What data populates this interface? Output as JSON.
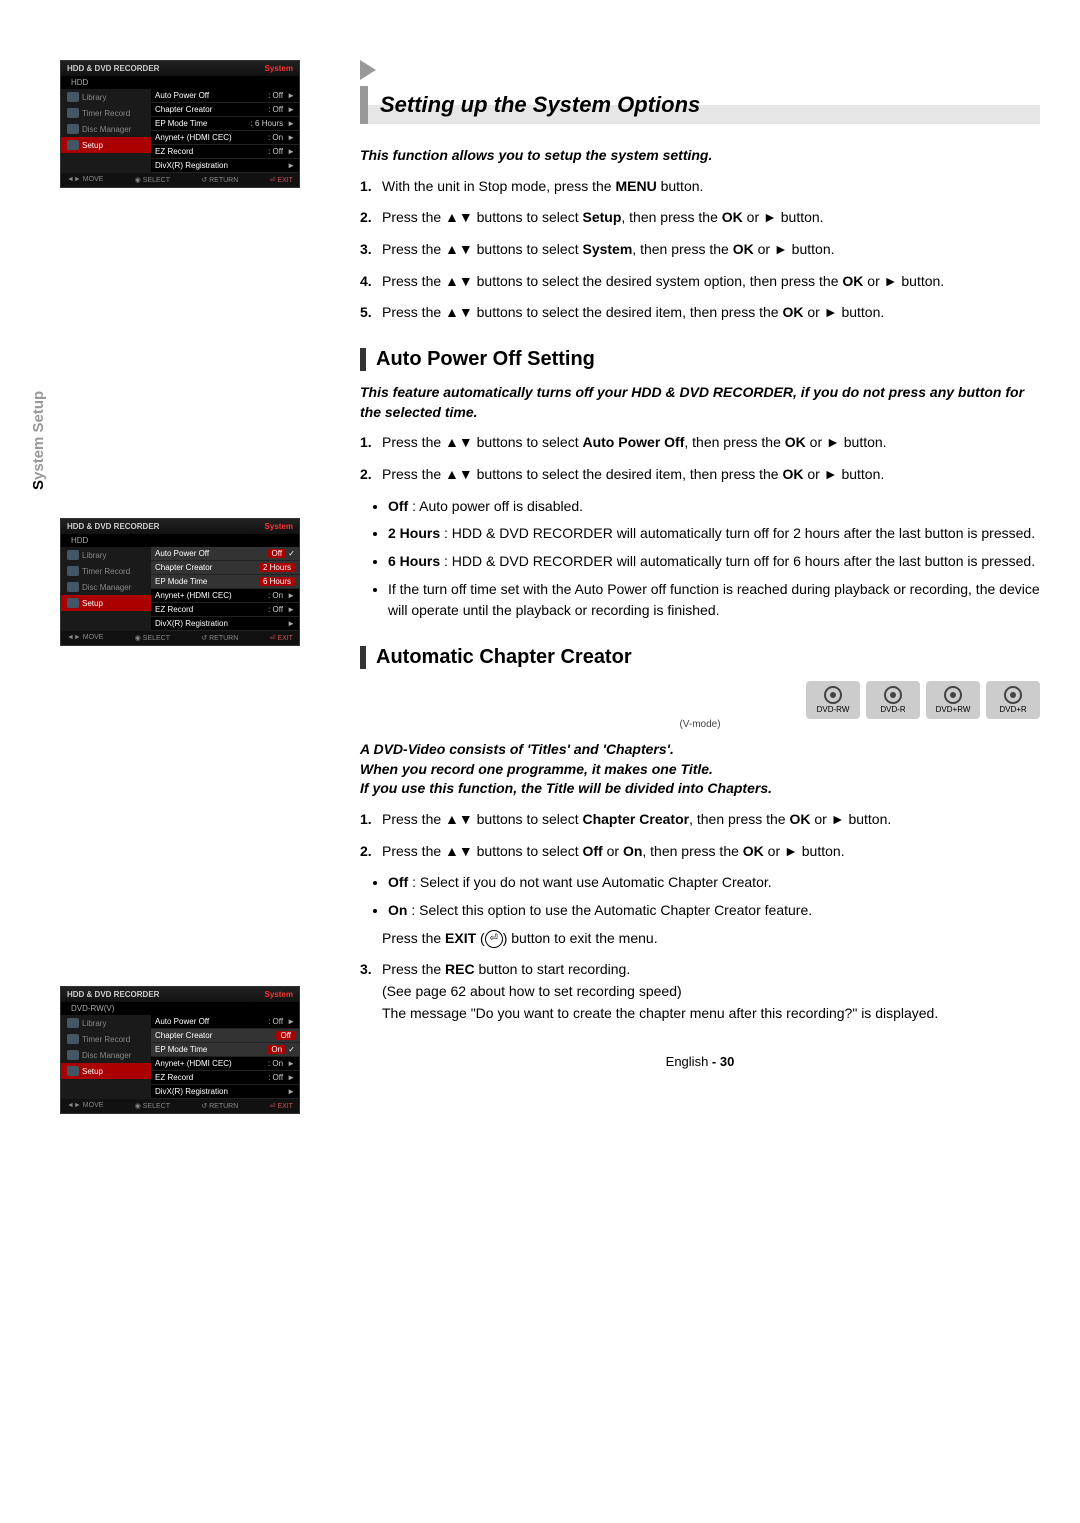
{
  "sideLabel": {
    "first": "S",
    "rest": "ystem Setup"
  },
  "osd": {
    "title": "HDD & DVD RECORDER",
    "system": "System",
    "nav": [
      "Library",
      "Timer Record",
      "Disc Manager",
      "Setup"
    ],
    "footer": {
      "move": "◄► MOVE",
      "select": "◉ SELECT",
      "return": "↺ RETURN",
      "exit": "⏎ EXIT"
    },
    "screen1": {
      "sub": "HDD",
      "rows": [
        {
          "label": "Auto Power Off",
          "val": ": Off",
          "arrow": "►"
        },
        {
          "label": "Chapter Creator",
          "val": ": Off",
          "arrow": "►"
        },
        {
          "label": "EP Mode Time",
          "val": ": 6 Hours",
          "arrow": "►"
        },
        {
          "label": "Anynet+ (HDMI CEC)",
          "val": ": On",
          "arrow": "►"
        },
        {
          "label": "EZ Record",
          "val": ": Off",
          "arrow": "►"
        },
        {
          "label": "DivX(R) Registration",
          "val": "",
          "arrow": "►"
        }
      ]
    },
    "screen2": {
      "sub": "HDD",
      "rows": [
        {
          "label": "Auto Power Off",
          "box": "Off",
          "check": "✓"
        },
        {
          "label": "Chapter Creator",
          "box": "2 Hours"
        },
        {
          "label": "EP Mode Time",
          "box": "6 Hours"
        },
        {
          "label": "Anynet+ (HDMI CEC)",
          "val": ": On",
          "arrow": "►"
        },
        {
          "label": "EZ Record",
          "val": ": Off",
          "arrow": "►"
        },
        {
          "label": "DivX(R) Registration",
          "val": "",
          "arrow": "►"
        }
      ]
    },
    "screen3": {
      "sub": "DVD-RW(V)",
      "rows": [
        {
          "label": "Auto Power Off",
          "val": ": Off",
          "arrow": "►"
        },
        {
          "label": "Chapter Creator",
          "box": "Off"
        },
        {
          "label": "EP Mode Time",
          "box": "On",
          "check": "✓"
        },
        {
          "label": "Anynet+ (HDMI CEC)",
          "val": ": On",
          "arrow": "►"
        },
        {
          "label": "EZ Record",
          "val": ": Off",
          "arrow": "►"
        },
        {
          "label": "DivX(R) Registration",
          "val": "",
          "arrow": "►"
        }
      ]
    }
  },
  "section1": {
    "title": "Setting up the System Options",
    "intro": "This function allows you to setup the system setting.",
    "steps": [
      {
        "n": "1.",
        "html": "With the unit in Stop mode, press the <b>MENU</b> button."
      },
      {
        "n": "2.",
        "html": "Press the ▲▼ buttons to select <b>Setup</b>, then press the <b>OK</b> or ► button."
      },
      {
        "n": "3.",
        "html": "Press the ▲▼ buttons to select <b>System</b>, then press the <b>OK</b> or ► button."
      },
      {
        "n": "4.",
        "html": "Press the ▲▼ buttons to select the desired  system option, then press the <b>OK</b> or ► button."
      },
      {
        "n": "5.",
        "html": "Press the ▲▼ buttons to select the desired item, then press the <b>OK</b> or ► button."
      }
    ]
  },
  "section2": {
    "title": "Auto Power Off Setting",
    "intro": "This feature automatically turns off your HDD & DVD RECORDER, if you do not press any button for the selected time.",
    "steps": [
      {
        "n": "1.",
        "html": "Press the ▲▼ buttons to select <b>Auto Power Off</b>, then press the <b>OK</b> or ► button."
      },
      {
        "n": "2.",
        "html": "Press the ▲▼ buttons to select the desired item, then press the <b>OK</b> or ► button."
      }
    ],
    "bullets": [
      "<b>Off</b> : Auto power off is disabled.",
      "<b>2 Hours</b> : HDD & DVD RECORDER will automatically turn off for 2 hours after the last button is pressed.",
      "<b>6 Hours</b> : HDD & DVD RECORDER will automatically turn off for 6 hours after the last button is pressed.",
      "If the turn off time set with the Auto Power off function is reached during playback or recording, the device will operate until the playback or recording is finished."
    ]
  },
  "section3": {
    "title": "Automatic Chapter Creator",
    "discs": [
      "DVD-RW",
      "DVD-R",
      "DVD+RW",
      "DVD+R"
    ],
    "vmode": "(V-mode)",
    "intro": "A DVD-Video consists of 'Titles' and 'Chapters'.\nWhen you record one programme, it makes one Title.\nIf you use this function, the Title will be divided into Chapters.",
    "steps": [
      {
        "n": "1.",
        "html": "Press the ▲▼ buttons to select <b>Chapter Creator</b>, then press the <b>OK</b> or ► button."
      },
      {
        "n": "2.",
        "html": "Press the ▲▼ buttons to select <b>Off</b> or <b>On</b>, then press the <b>OK</b> or ► button."
      }
    ],
    "bullets2": [
      "<b>Off</b> : Select if you do not want use Automatic Chapter Creator.",
      "<b>On</b> : Select this option to use the Automatic Chapter Creator feature."
    ],
    "exitLine": "Press the <b>EXIT</b> (<span class=\"exit-circle\">⏎</span>) button to exit the menu.",
    "step3": {
      "n": "3.",
      "html": "Press the <b>REC</b> button to start recording.<br>(See page 62 about how to set recording speed)<br>The message \"Do you want to create the chapter menu after this recording?\" is displayed."
    }
  },
  "footer": {
    "lang": "English",
    "page": "- 30"
  }
}
